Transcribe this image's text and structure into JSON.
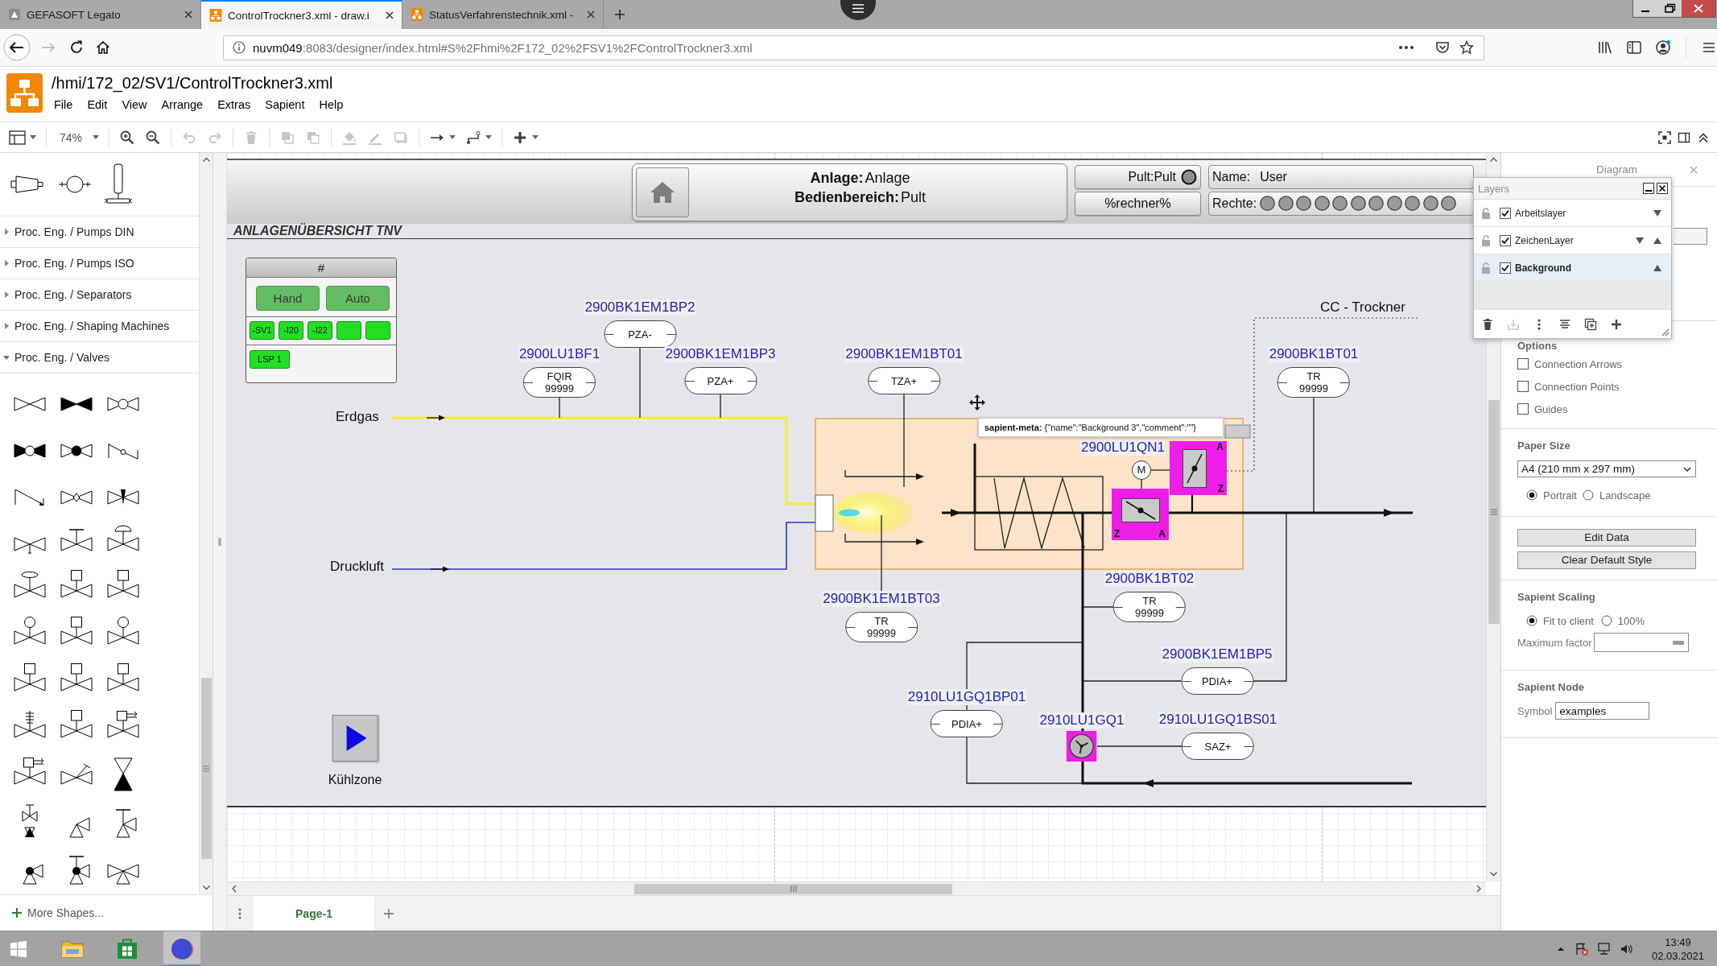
{
  "browser": {
    "tabs": [
      {
        "title": "GEFASOFT Legato",
        "selected": false,
        "kind": "page"
      },
      {
        "title": "ControlTrockner3.xml - draw.i",
        "selected": true,
        "kind": "diagram"
      },
      {
        "title": "StatusVerfahrenstechnik.xml -",
        "selected": false,
        "kind": "diagram"
      }
    ],
    "address": {
      "host": "nuvm049",
      "path": ":8083/designer/index.html#S%2Fhmi%2F172_02%2FSV1%2FControlTrockner3.xml"
    }
  },
  "app": {
    "title": "/hmi/172_02/SV1/ControlTrockner3.xml",
    "menu": [
      "File",
      "Edit",
      "View",
      "Arrange",
      "Extras",
      "Sapient",
      "Help"
    ]
  },
  "toolbar": {
    "zoom": "74%",
    "tools": [
      {
        "kind": "zoom_in",
        "disabled": false
      },
      {
        "kind": "zoom_out",
        "disabled": false
      },
      {
        "kind": "undo",
        "disabled": true
      },
      {
        "kind": "redo",
        "disabled": true
      },
      {
        "kind": "delete",
        "disabled": true
      },
      {
        "kind": "to_front",
        "disabled": true
      },
      {
        "kind": "to_back",
        "disabled": true
      },
      {
        "kind": "fill_color",
        "disabled": true
      },
      {
        "kind": "line_color",
        "disabled": true
      },
      {
        "kind": "shadow",
        "disabled": true
      },
      {
        "kind": "connection",
        "disabled": false
      },
      {
        "kind": "waypoints",
        "disabled": false
      },
      {
        "kind": "insert",
        "disabled": false
      }
    ]
  },
  "shape_sidebar": {
    "categories": [
      {
        "label": "Proc. Eng. / Pumps DIN",
        "expanded": false
      },
      {
        "label": "Proc. Eng. / Pumps ISO",
        "expanded": false
      },
      {
        "label": "Proc. Eng. / Separators",
        "expanded": false
      },
      {
        "label": "Proc. Eng. / Shaping Machines",
        "expanded": false
      },
      {
        "label": "Proc. Eng. / Valves",
        "expanded": true
      }
    ],
    "more_shapes": "More Shapes..."
  },
  "hmi": {
    "header": {
      "plant_label": "Anlage:",
      "plant_value": "Anlage",
      "area_label": "Bedienbereich:",
      "area_value": "Pult",
      "console_button": "Pult:Pult",
      "computer_button": "%rechner%",
      "name_label": "Name:",
      "name_value": "User",
      "rights_label": "Rechte:"
    },
    "title": "ANLAGENÜBERSICHT TNV",
    "mode_panel": {
      "heading": "#",
      "modes": [
        "Hand",
        "Auto"
      ],
      "units": [
        {
          "kind": "labeled",
          "label": "-SV1"
        },
        {
          "kind": "labeled",
          "label": "-I20"
        },
        {
          "kind": "labeled",
          "label": "-I22"
        },
        {
          "kind": "blank"
        },
        {
          "kind": "blank"
        }
      ],
      "lines": [
        "LSP 1"
      ]
    },
    "media": [
      {
        "label": "Erdgas",
        "kind": "gas"
      },
      {
        "label": "Druckluft",
        "kind": "air"
      }
    ],
    "section_label": "CC - Trockner",
    "instruments": [
      {
        "tag": "2900BK1EM1BP2",
        "function": "PZA-"
      },
      {
        "tag": "2900LU1BF1",
        "function": "FQIR",
        "reading": "99999"
      },
      {
        "tag": "2900BK1EM1BP3",
        "function": "PZA+"
      },
      {
        "tag": "2900BK1EM1BT01",
        "function": "TZA+"
      },
      {
        "tag": "2900BK1BT01",
        "function": "TR",
        "reading": "99999"
      },
      {
        "tag": "2900BK1EM1BT03",
        "function": "TR",
        "reading": "99999"
      },
      {
        "tag": "2900BK1BT02",
        "function": "TR",
        "reading": "99999"
      },
      {
        "tag": "2900BK1EM1BP5",
        "function": "PDIA+"
      },
      {
        "tag": "2910LU1GQ1BP01",
        "function": "PDIA+"
      },
      {
        "tag": "2910LU1GQ1BS01",
        "function": "SAZ+"
      }
    ],
    "damper": {
      "tag": "2900LU1QN1",
      "motor_label": "M",
      "valves": [
        {
          "open_label": "A",
          "closed_label": "Z"
        },
        {
          "open_label": "A",
          "closed_label": "Z"
        }
      ]
    },
    "fan": {
      "tag": "2910LU1GQ1"
    },
    "start_button": {
      "label": "Kühlzone"
    },
    "tooltip": "**sapient-meta:** {\"name\":\"Background 3\",\"comment\":\"\"}"
  },
  "layers_panel": {
    "title": "Layers",
    "layers": [
      {
        "name": "Arbeitslayer",
        "visible": true,
        "locked": false,
        "selected": false,
        "can_move_down": true,
        "can_move_up": false
      },
      {
        "name": "ZeichenLayer",
        "visible": true,
        "locked": false,
        "selected": false,
        "can_move_down": true,
        "can_move_up": true
      },
      {
        "name": "Background",
        "visible": true,
        "locked": false,
        "selected": true,
        "can_move_down": false,
        "can_move_up": true
      }
    ],
    "tools": [
      {
        "kind": "delete",
        "disabled": false
      },
      {
        "kind": "move_selection",
        "disabled": true
      },
      {
        "kind": "menu",
        "disabled": false
      },
      {
        "kind": "edit_data",
        "disabled": false
      },
      {
        "kind": "duplicate",
        "disabled": false
      },
      {
        "kind": "add",
        "disabled": false
      }
    ]
  },
  "format_panel": {
    "tab": "Diagram",
    "options": {
      "heading": "Options",
      "items": [
        {
          "label": "Connection Arrows",
          "checked": false
        },
        {
          "label": "Connection Points",
          "checked": false
        },
        {
          "label": "Guides",
          "checked": false
        }
      ]
    },
    "paper": {
      "heading": "Paper Size",
      "size": "A4 (210 mm x 297 mm)",
      "orientations": [
        {
          "label": "Portrait",
          "selected": true
        },
        {
          "label": "Landscape",
          "selected": false
        }
      ]
    },
    "actions": [
      "Edit Data",
      "Clear Default Style"
    ],
    "scaling": {
      "heading": "Sapient Scaling",
      "modes": [
        {
          "label": "Fit to client",
          "selected": true
        },
        {
          "label": "100%",
          "selected": false
        }
      ],
      "max_factor_label": "Maximum factor"
    },
    "node": {
      "heading": "Sapient Node",
      "symbol_label": "Symbol",
      "symbol_value": "examples"
    }
  },
  "pages": [
    {
      "label": "Page-1",
      "selected": true
    }
  ],
  "taskbar": {
    "apps": [
      {
        "kind": "files",
        "selected": false
      },
      {
        "kind": "store",
        "selected": false
      },
      {
        "kind": "browser",
        "selected": true
      }
    ],
    "time": "13:49",
    "date": "02.03.2021"
  }
}
